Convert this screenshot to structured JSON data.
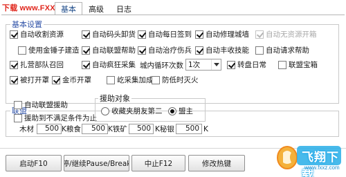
{
  "watermark": "下载 www.FXXZ.com",
  "tabs": [
    "基本",
    "高级",
    "日志"
  ],
  "basic": {
    "title": "基本设置",
    "options": [
      {
        "label": "自动收割资源",
        "checked": true
      },
      {
        "label": "自动码头卸货",
        "checked": true
      },
      {
        "label": "自动每日签到",
        "checked": true
      },
      {
        "label": "自动修理城墙",
        "checked": true
      },
      {
        "label": "自动无资源开箱",
        "checked": true,
        "disabled": true
      },
      {
        "label": "使用金锤子建造",
        "checked": false
      },
      {
        "label": "自动联盟帮助",
        "checked": true
      },
      {
        "label": "自动治疗伤兵",
        "checked": true
      },
      {
        "label": "自动丰收技能",
        "checked": true
      },
      {
        "label": "自动请求帮助",
        "checked": false
      },
      {
        "label": "扎营部队召回",
        "checked": true
      },
      {
        "label": "自动疯狂采集",
        "checked": true
      },
      {
        "label": "转盘日常",
        "checked": true
      },
      {
        "label": "联盟宝箱",
        "checked": false
      },
      {
        "label": "被打开罩",
        "checked": true
      },
      {
        "label": "金币开罩",
        "checked": true
      },
      {
        "label": "屹采集加成",
        "checked": false
      },
      {
        "label": "防低时灭火",
        "checked": false
      }
    ],
    "loop_label": "城内循环次数",
    "loop_value": "1次"
  },
  "league": {
    "title": "联盟",
    "auto_help": {
      "label": "自动联盟援助",
      "checked": false
    },
    "help_shortfall": {
      "label": "援助到不满足条件为止",
      "checked": false
    },
    "target_title": "援助对象",
    "targets": [
      {
        "label": "收藏夹朋友第二",
        "selected": false
      },
      {
        "label": "盟主",
        "selected": true
      }
    ],
    "resources": [
      {
        "label": "木材",
        "value": "500"
      },
      {
        "label": "K粮食",
        "value": "500"
      },
      {
        "label": "K铁矿",
        "value": "500"
      },
      {
        "label": "K秘银",
        "value": "500"
      }
    ],
    "unit": "K"
  },
  "buttons": {
    "start": "启动F10",
    "pause": "停/继续Pause/Break",
    "stop": "中止F12",
    "hotkey": "修改热键"
  },
  "logo": {
    "text": "飞翔下载",
    "sub": "www.fxxz.com"
  }
}
